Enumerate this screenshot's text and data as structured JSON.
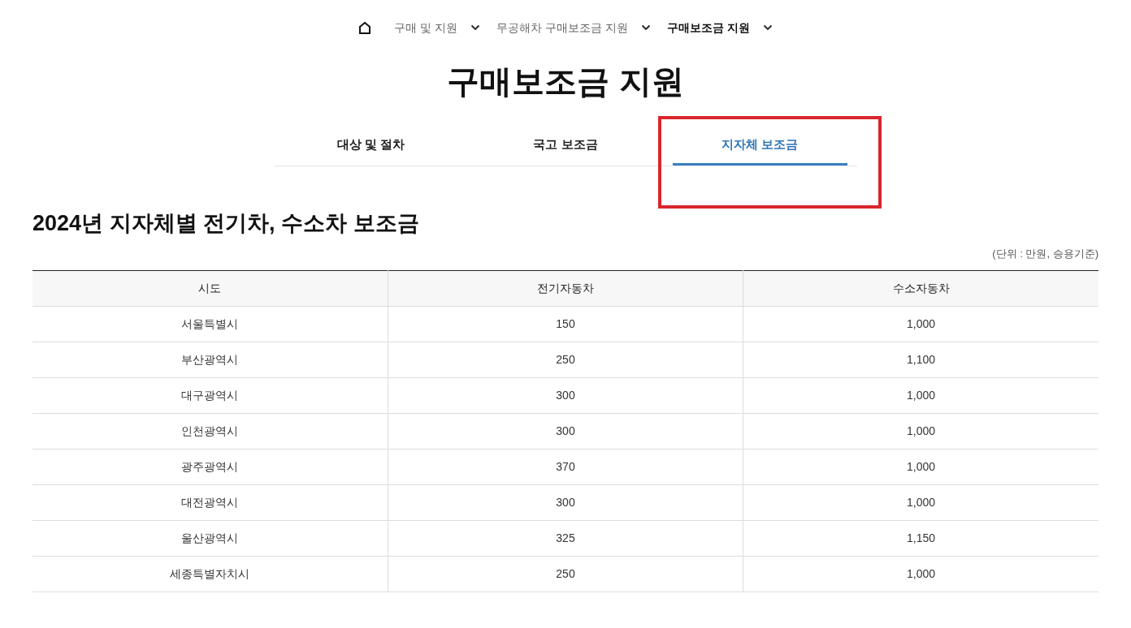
{
  "breadcrumb": [
    {
      "label": "구매 및 지원",
      "selected": false
    },
    {
      "label": "무공해차 구매보조금 지원",
      "selected": false
    },
    {
      "label": "구매보조금 지원",
      "selected": true
    }
  ],
  "page_title": "구매보조금 지원",
  "tabs": [
    {
      "label": "대상 및 절차",
      "selected": false
    },
    {
      "label": "국고 보조금",
      "selected": false
    },
    {
      "label": "지자체 보조금",
      "selected": true
    }
  ],
  "section_title": "2024년 지자체별 전기차, 수소차 보조금",
  "unit_note": "(단위 : 만원, 승용기준)",
  "table": {
    "columns": [
      "시도",
      "전기자동차",
      "수소자동차"
    ],
    "rows": [
      [
        "서울특별시",
        "150",
        "1,000"
      ],
      [
        "부산광역시",
        "250",
        "1,100"
      ],
      [
        "대구광역시",
        "300",
        "1,000"
      ],
      [
        "인천광역시",
        "300",
        "1,000"
      ],
      [
        "광주광역시",
        "370",
        "1,000"
      ],
      [
        "대전광역시",
        "300",
        "1,000"
      ],
      [
        "울산광역시",
        "325",
        "1,150"
      ],
      [
        "세종특별자치시",
        "250",
        "1,000"
      ]
    ]
  }
}
